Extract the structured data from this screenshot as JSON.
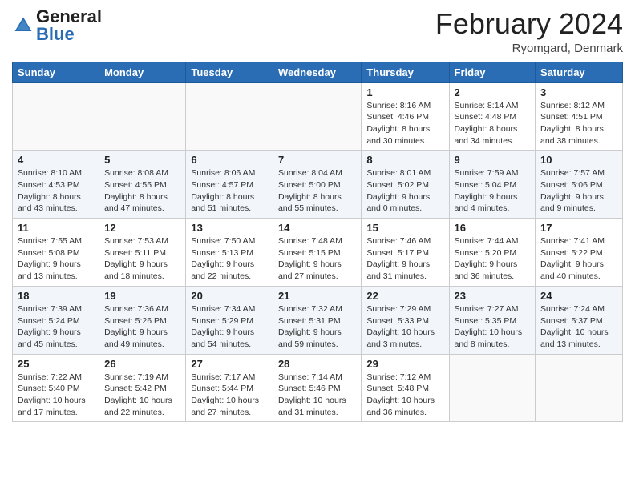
{
  "header": {
    "logo_general": "General",
    "logo_blue": "Blue",
    "month_year": "February 2024",
    "location": "Ryomgard, Denmark"
  },
  "weekdays": [
    "Sunday",
    "Monday",
    "Tuesday",
    "Wednesday",
    "Thursday",
    "Friday",
    "Saturday"
  ],
  "weeks": [
    [
      {
        "day": "",
        "info": ""
      },
      {
        "day": "",
        "info": ""
      },
      {
        "day": "",
        "info": ""
      },
      {
        "day": "",
        "info": ""
      },
      {
        "day": "1",
        "info": "Sunrise: 8:16 AM\nSunset: 4:46 PM\nDaylight: 8 hours\nand 30 minutes."
      },
      {
        "day": "2",
        "info": "Sunrise: 8:14 AM\nSunset: 4:48 PM\nDaylight: 8 hours\nand 34 minutes."
      },
      {
        "day": "3",
        "info": "Sunrise: 8:12 AM\nSunset: 4:51 PM\nDaylight: 8 hours\nand 38 minutes."
      }
    ],
    [
      {
        "day": "4",
        "info": "Sunrise: 8:10 AM\nSunset: 4:53 PM\nDaylight: 8 hours\nand 43 minutes."
      },
      {
        "day": "5",
        "info": "Sunrise: 8:08 AM\nSunset: 4:55 PM\nDaylight: 8 hours\nand 47 minutes."
      },
      {
        "day": "6",
        "info": "Sunrise: 8:06 AM\nSunset: 4:57 PM\nDaylight: 8 hours\nand 51 minutes."
      },
      {
        "day": "7",
        "info": "Sunrise: 8:04 AM\nSunset: 5:00 PM\nDaylight: 8 hours\nand 55 minutes."
      },
      {
        "day": "8",
        "info": "Sunrise: 8:01 AM\nSunset: 5:02 PM\nDaylight: 9 hours\nand 0 minutes."
      },
      {
        "day": "9",
        "info": "Sunrise: 7:59 AM\nSunset: 5:04 PM\nDaylight: 9 hours\nand 4 minutes."
      },
      {
        "day": "10",
        "info": "Sunrise: 7:57 AM\nSunset: 5:06 PM\nDaylight: 9 hours\nand 9 minutes."
      }
    ],
    [
      {
        "day": "11",
        "info": "Sunrise: 7:55 AM\nSunset: 5:08 PM\nDaylight: 9 hours\nand 13 minutes."
      },
      {
        "day": "12",
        "info": "Sunrise: 7:53 AM\nSunset: 5:11 PM\nDaylight: 9 hours\nand 18 minutes."
      },
      {
        "day": "13",
        "info": "Sunrise: 7:50 AM\nSunset: 5:13 PM\nDaylight: 9 hours\nand 22 minutes."
      },
      {
        "day": "14",
        "info": "Sunrise: 7:48 AM\nSunset: 5:15 PM\nDaylight: 9 hours\nand 27 minutes."
      },
      {
        "day": "15",
        "info": "Sunrise: 7:46 AM\nSunset: 5:17 PM\nDaylight: 9 hours\nand 31 minutes."
      },
      {
        "day": "16",
        "info": "Sunrise: 7:44 AM\nSunset: 5:20 PM\nDaylight: 9 hours\nand 36 minutes."
      },
      {
        "day": "17",
        "info": "Sunrise: 7:41 AM\nSunset: 5:22 PM\nDaylight: 9 hours\nand 40 minutes."
      }
    ],
    [
      {
        "day": "18",
        "info": "Sunrise: 7:39 AM\nSunset: 5:24 PM\nDaylight: 9 hours\nand 45 minutes."
      },
      {
        "day": "19",
        "info": "Sunrise: 7:36 AM\nSunset: 5:26 PM\nDaylight: 9 hours\nand 49 minutes."
      },
      {
        "day": "20",
        "info": "Sunrise: 7:34 AM\nSunset: 5:29 PM\nDaylight: 9 hours\nand 54 minutes."
      },
      {
        "day": "21",
        "info": "Sunrise: 7:32 AM\nSunset: 5:31 PM\nDaylight: 9 hours\nand 59 minutes."
      },
      {
        "day": "22",
        "info": "Sunrise: 7:29 AM\nSunset: 5:33 PM\nDaylight: 10 hours\nand 3 minutes."
      },
      {
        "day": "23",
        "info": "Sunrise: 7:27 AM\nSunset: 5:35 PM\nDaylight: 10 hours\nand 8 minutes."
      },
      {
        "day": "24",
        "info": "Sunrise: 7:24 AM\nSunset: 5:37 PM\nDaylight: 10 hours\nand 13 minutes."
      }
    ],
    [
      {
        "day": "25",
        "info": "Sunrise: 7:22 AM\nSunset: 5:40 PM\nDaylight: 10 hours\nand 17 minutes."
      },
      {
        "day": "26",
        "info": "Sunrise: 7:19 AM\nSunset: 5:42 PM\nDaylight: 10 hours\nand 22 minutes."
      },
      {
        "day": "27",
        "info": "Sunrise: 7:17 AM\nSunset: 5:44 PM\nDaylight: 10 hours\nand 27 minutes."
      },
      {
        "day": "28",
        "info": "Sunrise: 7:14 AM\nSunset: 5:46 PM\nDaylight: 10 hours\nand 31 minutes."
      },
      {
        "day": "29",
        "info": "Sunrise: 7:12 AM\nSunset: 5:48 PM\nDaylight: 10 hours\nand 36 minutes."
      },
      {
        "day": "",
        "info": ""
      },
      {
        "day": "",
        "info": ""
      }
    ]
  ]
}
